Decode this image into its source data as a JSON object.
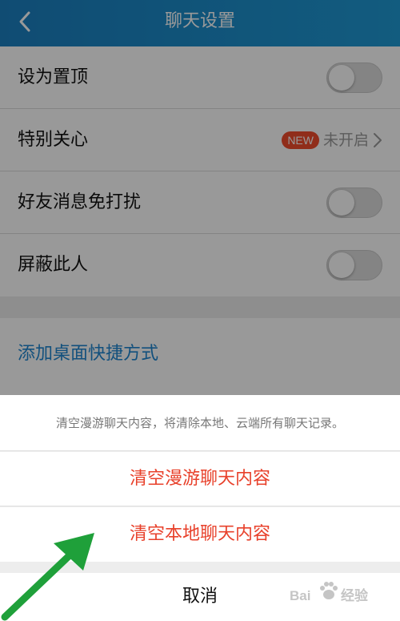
{
  "header": {
    "title": "聊天设置",
    "back_icon": "chevron-left-icon",
    "color_start": "#1b7fc0",
    "color_end": "#1e99d4"
  },
  "settings": {
    "rows": [
      {
        "label": "设为置顶",
        "control": "toggle",
        "on": false
      },
      {
        "label": "特别关心",
        "control": "link",
        "badge": "NEW",
        "status": "未开启",
        "icon": "chevron-right-icon"
      },
      {
        "label": "好友消息免打扰",
        "control": "toggle",
        "on": false
      },
      {
        "label": "屏蔽此人",
        "control": "toggle",
        "on": false
      }
    ],
    "shortcut_label": "添加桌面快捷方式",
    "link_color": "#1f86d0"
  },
  "action_sheet": {
    "description": "清空漫游聊天内容，将清除本地、云端所有聊天记录。",
    "options": [
      {
        "label": "清空漫游聊天内容"
      },
      {
        "label": "清空本地聊天内容"
      }
    ],
    "cancel_label": "取消",
    "destructive_color": "#e8412b"
  },
  "annotation": {
    "icon": "green-arrow-icon",
    "color": "#1fa03a"
  },
  "watermark": {
    "left_text": "Bai",
    "right_text": "经验",
    "icon": "paw-print-icon"
  }
}
